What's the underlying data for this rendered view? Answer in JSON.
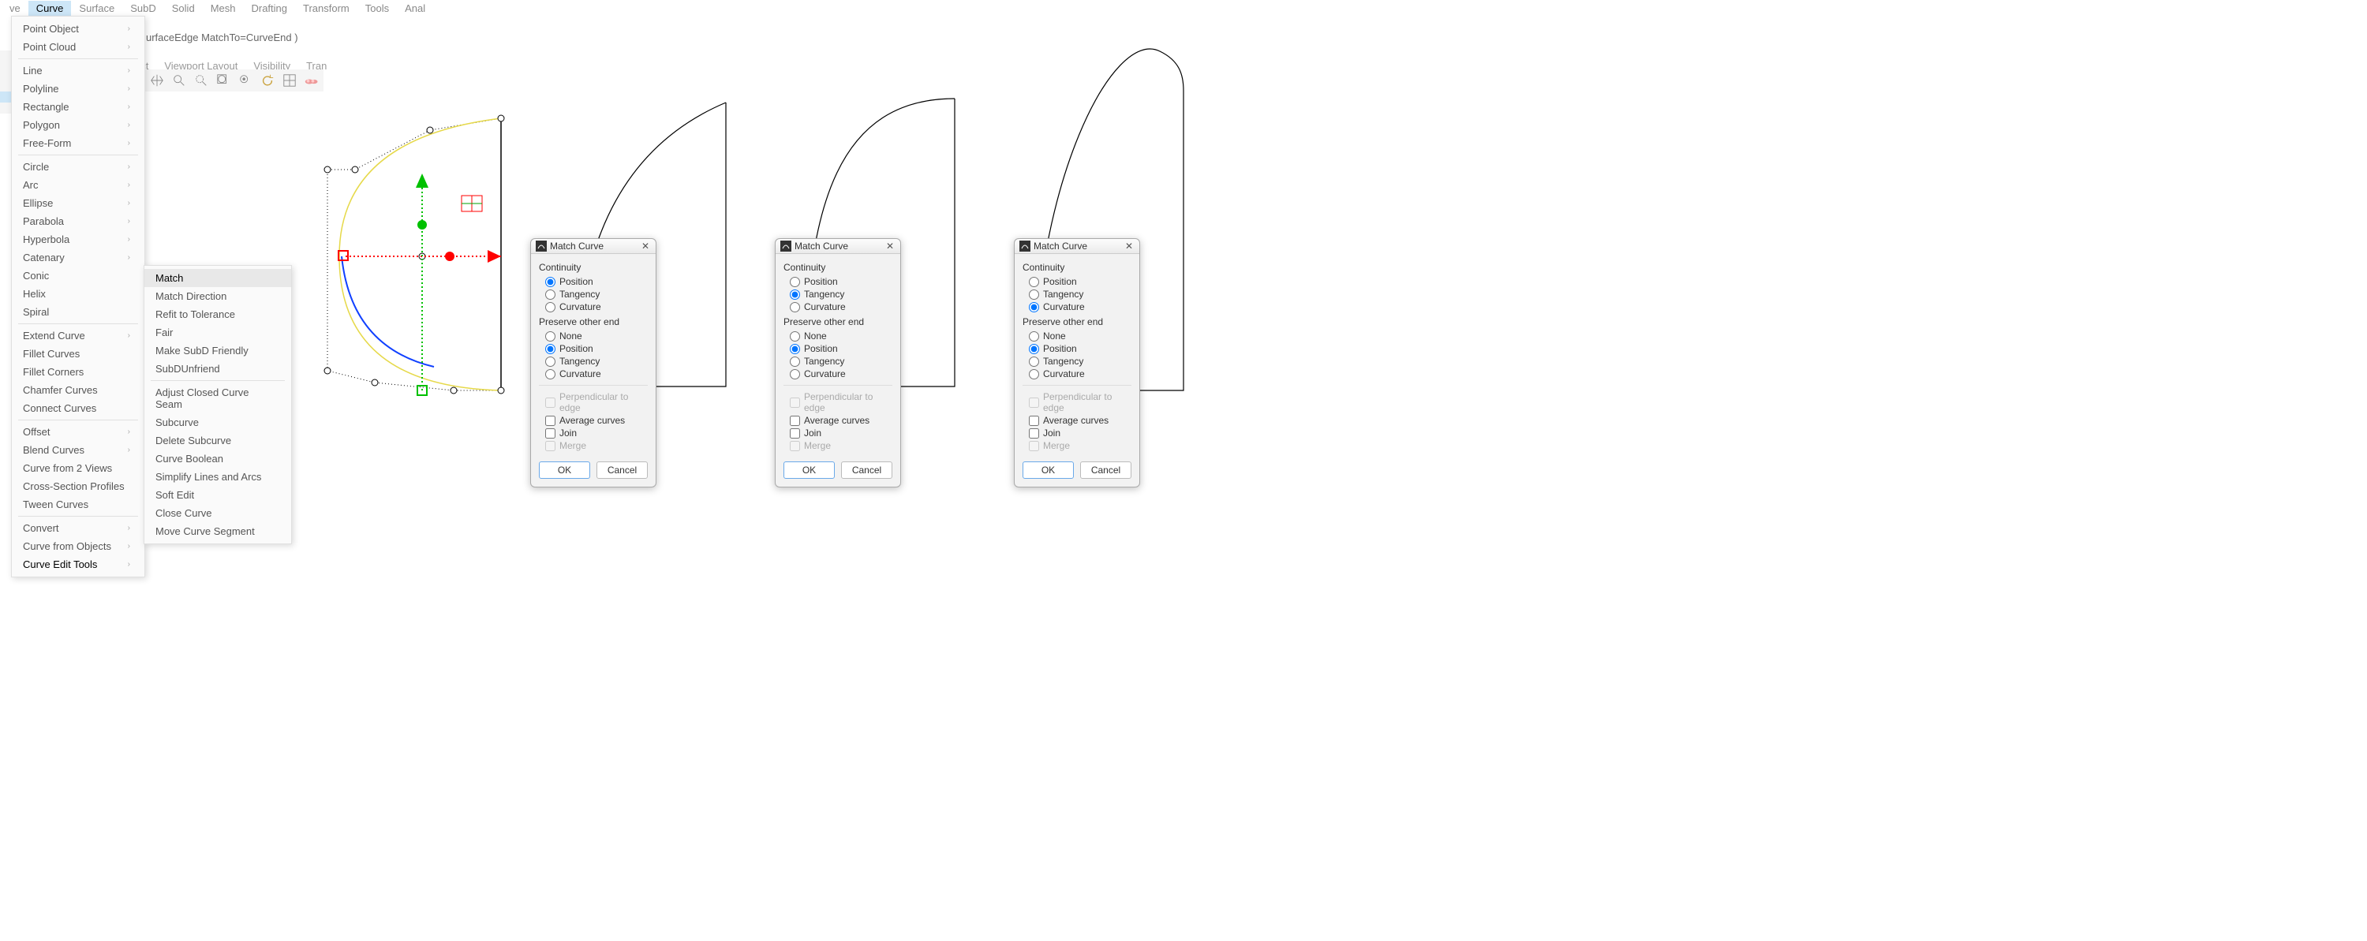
{
  "menubar": [
    "ve",
    "Curve",
    "Surface",
    "SubD",
    "Solid",
    "Mesh",
    "Drafting",
    "Transform",
    "Tools",
    "Anal"
  ],
  "cmdline": "urfaceEdge  MatchTo=CurveEnd )",
  "tabs": [
    "ect",
    "Viewport Layout",
    "Visibility",
    "Tran"
  ],
  "toolbar_icons": [
    "pan-icon",
    "zoom-icon",
    "zoom-window-icon",
    "zoom-extents-icon",
    "zoom-selected-icon",
    "refresh-icon",
    "grid-icon",
    "render-icon"
  ],
  "menu_curve": [
    {
      "label": "Point Object",
      "arrow": true
    },
    {
      "label": "Point Cloud",
      "arrow": true
    },
    {
      "sep": true
    },
    {
      "label": "Line",
      "arrow": true
    },
    {
      "label": "Polyline",
      "arrow": true
    },
    {
      "label": "Rectangle",
      "arrow": true
    },
    {
      "label": "Polygon",
      "arrow": true
    },
    {
      "label": "Free-Form",
      "arrow": true
    },
    {
      "sep": true
    },
    {
      "label": "Circle",
      "arrow": true
    },
    {
      "label": "Arc",
      "arrow": true
    },
    {
      "label": "Ellipse",
      "arrow": true
    },
    {
      "label": "Parabola",
      "arrow": true
    },
    {
      "label": "Hyperbola",
      "arrow": true
    },
    {
      "label": "Catenary",
      "arrow": true
    },
    {
      "label": "Conic"
    },
    {
      "label": "Helix"
    },
    {
      "label": "Spiral"
    },
    {
      "sep": true
    },
    {
      "label": "Extend Curve",
      "arrow": true
    },
    {
      "label": "Fillet Curves"
    },
    {
      "label": "Fillet Corners"
    },
    {
      "label": "Chamfer Curves"
    },
    {
      "label": "Connect Curves"
    },
    {
      "sep": true
    },
    {
      "label": "Offset",
      "arrow": true
    },
    {
      "label": "Blend Curves",
      "arrow": true
    },
    {
      "label": "Curve from 2 Views"
    },
    {
      "label": "Cross-Section Profiles"
    },
    {
      "label": "Tween Curves"
    },
    {
      "sep": true
    },
    {
      "label": "Convert",
      "arrow": true
    },
    {
      "label": "Curve from Objects",
      "arrow": true
    },
    {
      "label": "Curve Edit Tools",
      "arrow": true,
      "bold": true
    }
  ],
  "menu_edit": [
    {
      "label": "Match",
      "highlight": true
    },
    {
      "label": "Match Direction"
    },
    {
      "label": "Refit to Tolerance"
    },
    {
      "label": "Fair"
    },
    {
      "label": "Make SubD Friendly"
    },
    {
      "label": "SubDUnfriend"
    },
    {
      "sep": true
    },
    {
      "label": "Adjust Closed Curve Seam"
    },
    {
      "label": "Subcurve"
    },
    {
      "label": "Delete Subcurve"
    },
    {
      "label": "Curve Boolean"
    },
    {
      "label": "Simplify Lines and Arcs"
    },
    {
      "label": "Soft Edit"
    },
    {
      "label": "Close Curve"
    },
    {
      "label": "Move Curve Segment"
    }
  ],
  "dialog": {
    "title": "Match Curve",
    "continuity_label": "Continuity",
    "opts_continuity": [
      "Position",
      "Tangency",
      "Curvature"
    ],
    "preserve_label": "Preserve other end",
    "opts_preserve": [
      "None",
      "Position",
      "Tangency",
      "Curvature"
    ],
    "chk_perp": "Perpendicular to edge",
    "chk_avg": "Average curves",
    "chk_join": "Join",
    "chk_merge": "Merge",
    "ok": "OK",
    "cancel": "Cancel"
  },
  "dialogs": [
    {
      "continuity": "Position",
      "preserve": "Position"
    },
    {
      "continuity": "Tangency",
      "preserve": "Position"
    },
    {
      "continuity": "Curvature",
      "preserve": "Position"
    }
  ]
}
